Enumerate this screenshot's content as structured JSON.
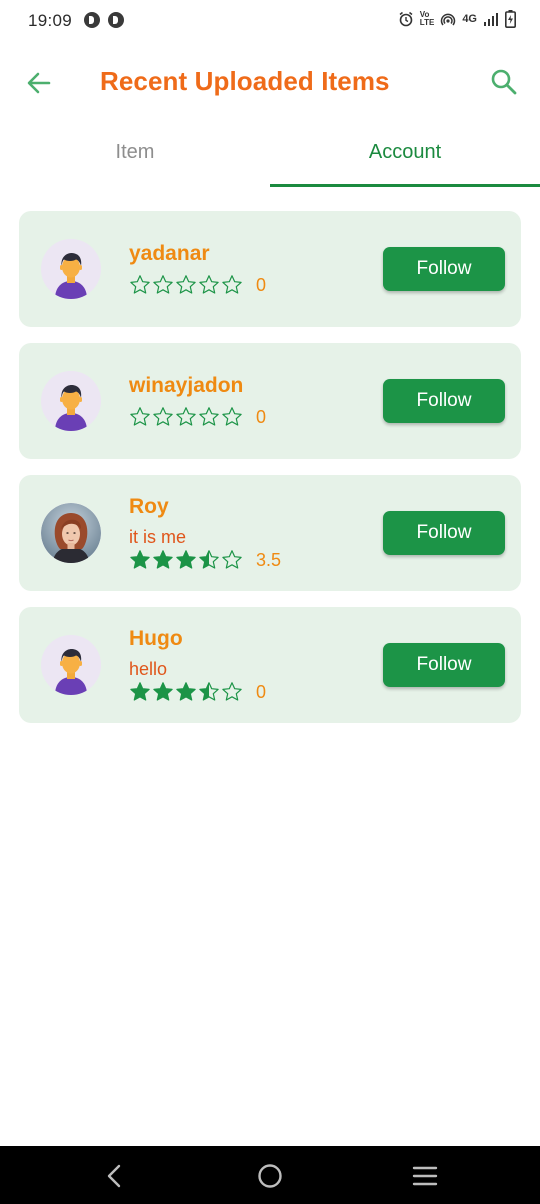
{
  "status_bar": {
    "time": "19:09",
    "network": "4G"
  },
  "toolbar": {
    "title": "Recent Uploaded Items"
  },
  "tabs": [
    {
      "label": "Item",
      "selected": false
    },
    {
      "label": "Account",
      "selected": true
    }
  ],
  "accounts": [
    {
      "name": "yadanar",
      "bio": "",
      "rating": 0,
      "rating_label": "0",
      "follow_label": "Follow",
      "avatar": "default-person-icon"
    },
    {
      "name": "winayjadon",
      "bio": "",
      "rating": 0,
      "rating_label": "0",
      "follow_label": "Follow",
      "avatar": "default-person-icon"
    },
    {
      "name": "Roy",
      "bio": "it is me",
      "rating": 3.5,
      "rating_label": "3.5",
      "follow_label": "Follow",
      "avatar": "profile-photo"
    },
    {
      "name": "Hugo",
      "bio": "hello",
      "rating": 3.5,
      "rating_label": "0",
      "follow_label": "Follow",
      "avatar": "default-person-icon"
    }
  ],
  "colors": {
    "accent_green": "#1c9447",
    "title_orange": "#ef6b19",
    "name_orange": "#ef8a12",
    "card_background": "#e6f2e8"
  }
}
